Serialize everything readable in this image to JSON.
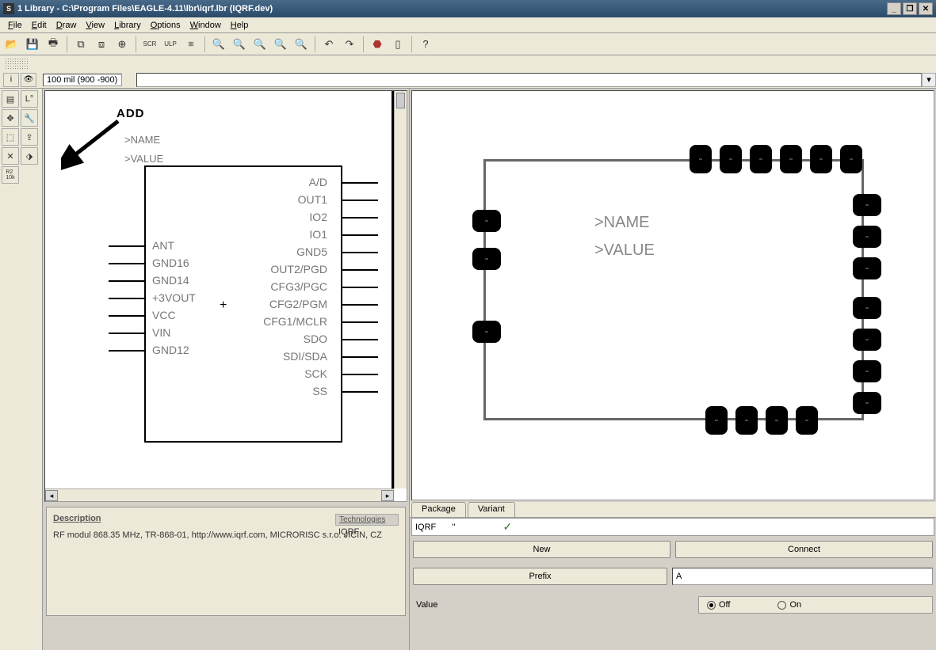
{
  "window": {
    "title": "1 Library - C:\\Program Files\\EAGLE-4.11\\lbr\\iqrf.lbr (IQRF.dev)"
  },
  "menu": [
    "File",
    "Edit",
    "Draw",
    "View",
    "Library",
    "Options",
    "Window",
    "Help"
  ],
  "toolbar_icons": [
    "open",
    "save",
    "print",
    "grp-use",
    "grp-unuse",
    "grp-dev",
    "ssh",
    "ssp",
    "hlp",
    "zoom-in",
    "zoom-out",
    "zoom-fit",
    "zoom-rect",
    "zoom-redraw",
    "undo",
    "redo",
    "stop",
    "script",
    "help"
  ],
  "coord": {
    "text": "100 mil (900 -900)",
    "cmd": ""
  },
  "toolbox": [
    [
      "info",
      "show"
    ],
    [
      "layer",
      "mark"
    ],
    [
      "move",
      "copy"
    ],
    [
      "select",
      "rotate"
    ],
    [
      "delete",
      "add"
    ],
    [
      "name",
      ""
    ],
    [
      "value",
      ""
    ]
  ],
  "symbol": {
    "add_label": "ADD",
    "name": ">NAME",
    "value": ">VALUE",
    "left_pins": [
      "ANT",
      "GND16",
      "GND14",
      "+3VOUT",
      "VCC",
      "VIN",
      "GND12"
    ],
    "right_pins": [
      "A/D",
      "OUT1",
      "IO2",
      "IO1",
      "GND5",
      "OUT2/PGD",
      "CFG3/PGC",
      "CFG2/PGM",
      "CFG1/MCLR",
      "SDO",
      "SDI/SDA",
      "SCK",
      "SS"
    ]
  },
  "description": {
    "header": "Description",
    "text": "RF modul 868.35 MHz, TR-868-01, http://www.iqrf.com, MICRORISC s.r.o. JICIN, CZ",
    "tech_header": "Technologies",
    "tech_value": "IQRF"
  },
  "package_view": {
    "name": ">NAME",
    "value": ">VALUE"
  },
  "tabs": {
    "col1": "Package",
    "col2": "Variant",
    "pkg": "IQRF",
    "variant": "''"
  },
  "buttons": {
    "new": "New",
    "connect": "Connect",
    "prefix": "Prefix",
    "prefix_val": "A"
  },
  "value_row": {
    "label": "Value",
    "off": "Off",
    "on": "On",
    "selected": "off"
  }
}
